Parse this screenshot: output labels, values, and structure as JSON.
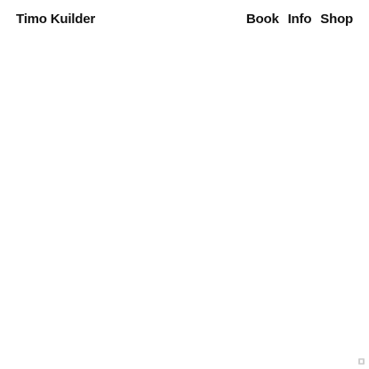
{
  "header": {
    "site_title": "Timo Kuilder",
    "nav": [
      {
        "label": "Book"
      },
      {
        "label": "Info"
      },
      {
        "label": "Shop"
      }
    ]
  },
  "corner_badge": {
    "icon": "page-icon",
    "color": "#cfcfcf"
  },
  "colors": {
    "background": "#ffffff",
    "text": "#111111"
  }
}
